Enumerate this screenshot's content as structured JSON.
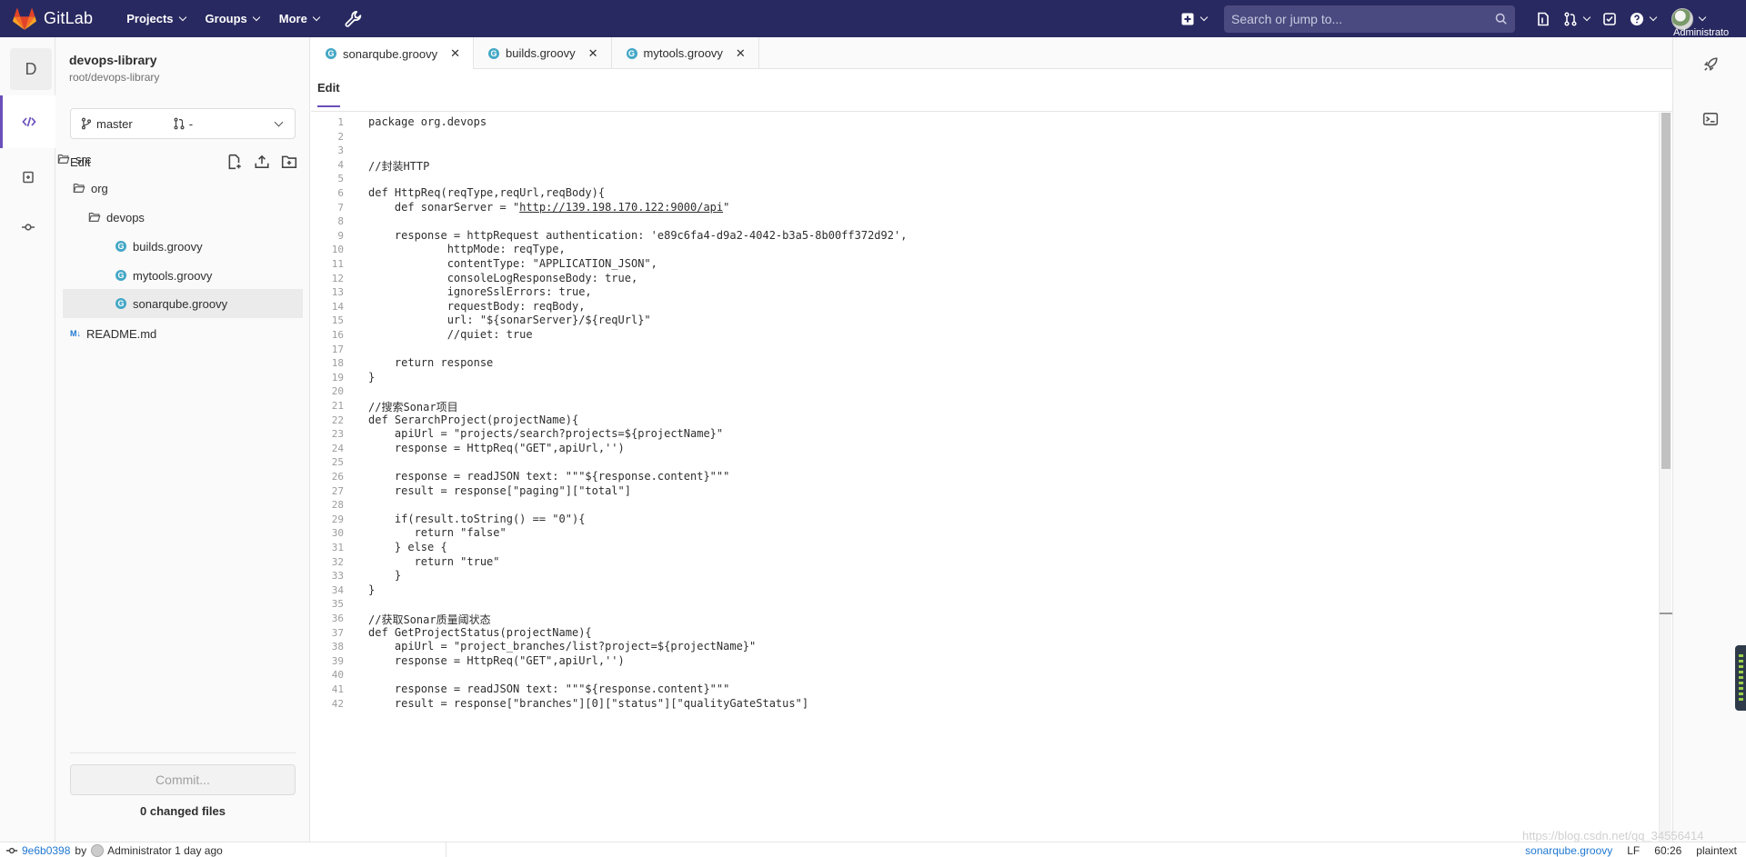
{
  "topnav": {
    "brand": "GitLab",
    "menu": [
      "Projects",
      "Groups",
      "More"
    ],
    "search_placeholder": "Search or jump to...",
    "user": "Administrato"
  },
  "project": {
    "avatar_letter": "D",
    "name": "devops-library",
    "path": "root/devops-library"
  },
  "branch": {
    "name": "master",
    "mr": "-"
  },
  "tree": {
    "edit_label": "Edit",
    "nodes": [
      "src",
      "org",
      "devops",
      "builds.groovy",
      "mytools.groovy",
      "sonarqube.groovy",
      "README.md"
    ],
    "md_badge": "M↓",
    "commit_label": "Commit...",
    "changed_files": "0 changed files"
  },
  "tabs": [
    "sonarqube.groovy",
    "builds.groovy",
    "mytools.groovy"
  ],
  "editor": {
    "subtab": "Edit",
    "lines": [
      "package org.devops",
      "",
      "",
      "//封装HTTP",
      "",
      "def HttpReq(reqType,reqUrl,reqBody){",
      "    def sonarServer = \"http://139.198.170.122:9000/api\"",
      "",
      "    response = httpRequest authentication: 'e89c6fa4-d9a2-4042-b3a5-8b00ff372d92',",
      "            httpMode: reqType,",
      "            contentType: \"APPLICATION_JSON\",",
      "            consoleLogResponseBody: true,",
      "            ignoreSslErrors: true,",
      "            requestBody: reqBody,",
      "            url: \"${sonarServer}/${reqUrl}\"",
      "            //quiet: true",
      "",
      "    return response",
      "}",
      "",
      "//搜索Sonar项目",
      "def SerarchProject(projectName){",
      "    apiUrl = \"projects/search?projects=${projectName}\"",
      "    response = HttpReq(\"GET\",apiUrl,'')",
      "",
      "    response = readJSON text: \"\"\"${response.content}\"\"\"",
      "    result = response[\"paging\"][\"total\"]",
      "",
      "    if(result.toString() == \"0\"){",
      "       return \"false\"",
      "    } else {",
      "       return \"true\"",
      "    }",
      "}",
      "",
      "//获取Sonar质量阈状态",
      "def GetProjectStatus(projectName){",
      "    apiUrl = \"project_branches/list?project=${projectName}\"",
      "    response = HttpReq(\"GET\",apiUrl,'')",
      "",
      "    response = readJSON text: \"\"\"${response.content}\"\"\"",
      "    result = response[\"branches\"][0][\"status\"][\"qualityGateStatus\"]"
    ]
  },
  "status": {
    "sha": "9e6b0398",
    "by": "by",
    "author_time": "Administrator 1 day ago",
    "file": "sonarqube.groovy",
    "eol": "LF",
    "pos": "60:26",
    "lang": "plaintext",
    "watermark": "https://blog.csdn.net/qq_34556414"
  },
  "colors": {
    "nav_bg": "#292961",
    "accent": "#6b4fbb",
    "link": "#1f78d1",
    "groovy_icon": "#43a7c6"
  }
}
